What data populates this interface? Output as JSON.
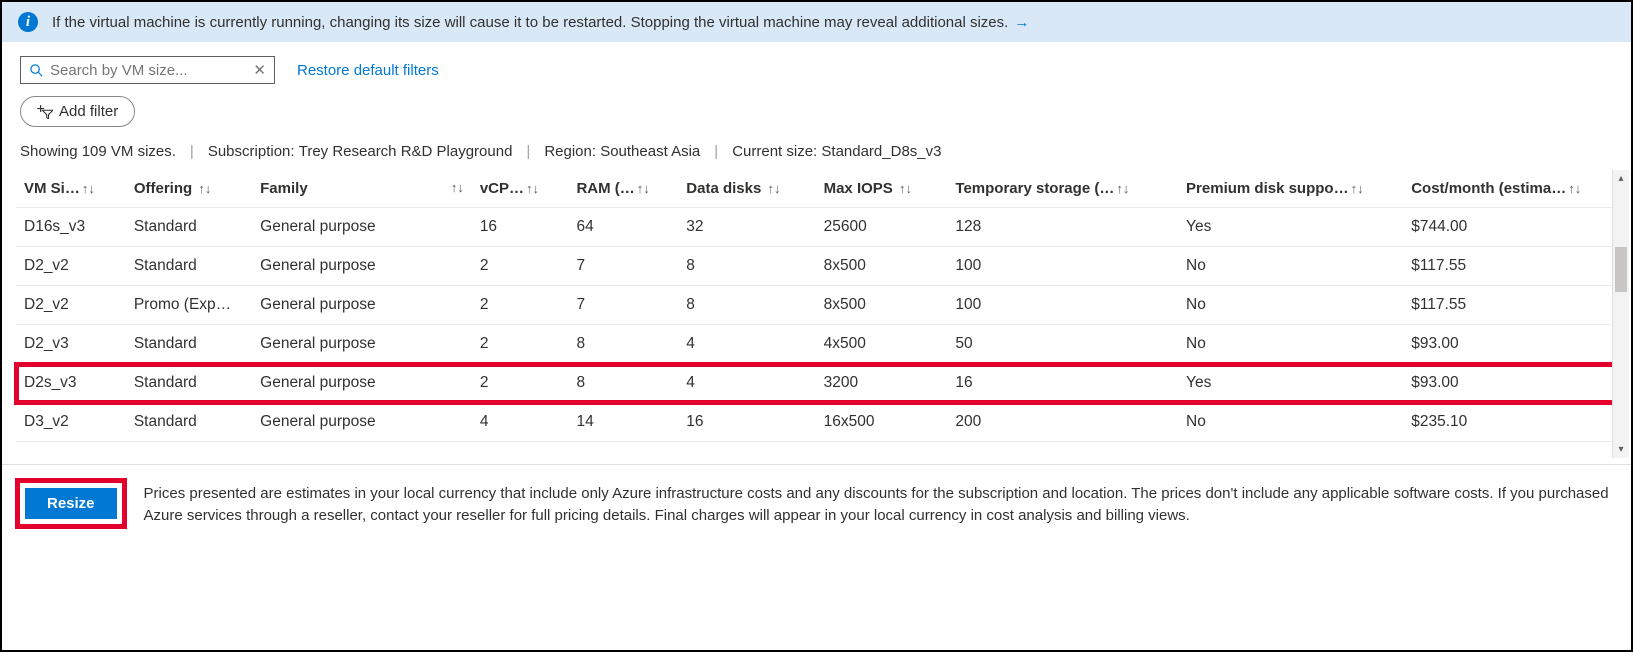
{
  "banner": {
    "text": "If the virtual machine is currently running, changing its size will cause it to be restarted. Stopping the virtual machine may reveal additional sizes.",
    "arrow": "→"
  },
  "toolbar": {
    "search_placeholder": "Search by VM size...",
    "restore_link": "Restore default filters",
    "add_filter_label": "Add filter"
  },
  "summary": {
    "showing": "Showing 109 VM sizes.",
    "subscription_label": "Subscription:",
    "subscription_value": "Trey Research R&D Playground",
    "region_label": "Region:",
    "region_value": "Southeast Asia",
    "current_label": "Current size:",
    "current_value": "Standard_D8s_v3"
  },
  "columns": {
    "size": "VM Si…",
    "offering": "Offering",
    "family": "Family",
    "vcpus": "vCP…",
    "ram": "RAM (…",
    "data_disks": "Data disks",
    "max_iops": "Max IOPS",
    "temp_storage": "Temporary storage (…",
    "premium": "Premium disk suppo…",
    "cost": "Cost/month (estima…"
  },
  "rows": [
    {
      "size": "D16s_v3",
      "offering": "Standard",
      "family": "General purpose",
      "vcpus": "16",
      "ram": "64",
      "data_disks": "32",
      "max_iops": "25600",
      "temp_storage": "128",
      "premium": "Yes",
      "cost": "$744.00",
      "hl": false
    },
    {
      "size": "D2_v2",
      "offering": "Standard",
      "family": "General purpose",
      "vcpus": "2",
      "ram": "7",
      "data_disks": "8",
      "max_iops": "8x500",
      "temp_storage": "100",
      "premium": "No",
      "cost": "$117.55",
      "hl": false
    },
    {
      "size": "D2_v2",
      "offering": "Promo (Exp…",
      "family": "General purpose",
      "vcpus": "2",
      "ram": "7",
      "data_disks": "8",
      "max_iops": "8x500",
      "temp_storage": "100",
      "premium": "No",
      "cost": "$117.55",
      "hl": false
    },
    {
      "size": "D2_v3",
      "offering": "Standard",
      "family": "General purpose",
      "vcpus": "2",
      "ram": "8",
      "data_disks": "4",
      "max_iops": "4x500",
      "temp_storage": "50",
      "premium": "No",
      "cost": "$93.00",
      "hl": false
    },
    {
      "size": "D2s_v3",
      "offering": "Standard",
      "family": "General purpose",
      "vcpus": "2",
      "ram": "8",
      "data_disks": "4",
      "max_iops": "3200",
      "temp_storage": "16",
      "premium": "Yes",
      "cost": "$93.00",
      "hl": true
    },
    {
      "size": "D3_v2",
      "offering": "Standard",
      "family": "General purpose",
      "vcpus": "4",
      "ram": "14",
      "data_disks": "16",
      "max_iops": "16x500",
      "temp_storage": "200",
      "premium": "No",
      "cost": "$235.10",
      "hl": false
    }
  ],
  "footer": {
    "resize_button": "Resize",
    "disclaimer": "Prices presented are estimates in your local currency that include only Azure infrastructure costs and any discounts for the subscription and location. The prices don't include any applicable software costs. If you purchased Azure services through a reseller, contact your reseller for full pricing details. Final charges will appear in your local currency in cost analysis and billing views."
  }
}
